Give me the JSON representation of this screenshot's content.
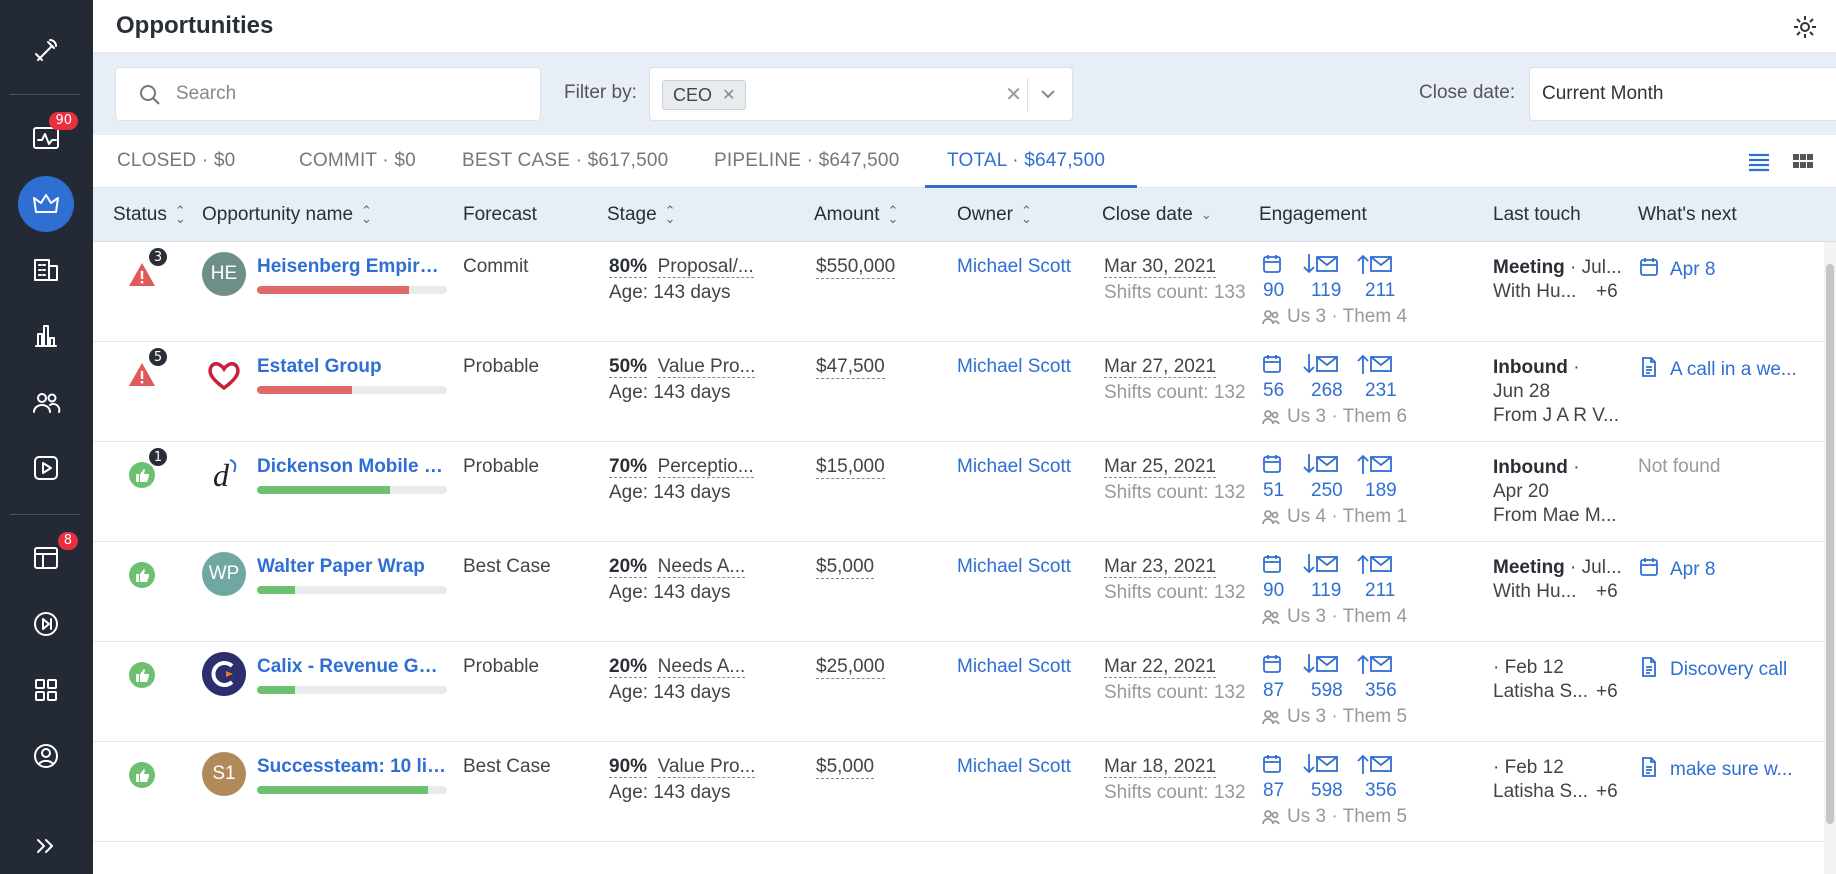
{
  "header": {
    "title": "Opportunities"
  },
  "sidebar": {
    "badges": {
      "activity": "90",
      "deals": "8"
    }
  },
  "filters": {
    "search_placeholder": "Search",
    "filter_label": "Filter by:",
    "filter_chip": "CEO",
    "close_label": "Close date:",
    "close_value": "Current Month"
  },
  "tabs": [
    {
      "label": "CLOSED · $0"
    },
    {
      "label": "COMMIT · $0"
    },
    {
      "label": "BEST CASE · $617,500"
    },
    {
      "label": "PIPELINE · $647,500"
    },
    {
      "label": "TOTAL · $647,500"
    }
  ],
  "columns": {
    "status": "Status",
    "name": "Opportunity name",
    "forecast": "Forecast",
    "stage": "Stage",
    "amount": "Amount",
    "owner": "Owner",
    "close": "Close date",
    "engagement": "Engagement",
    "last_touch": "Last touch",
    "whats_next": "What's next"
  },
  "colors": {
    "accent": "#2f6fd3",
    "danger": "#e05a5a",
    "success": "#6cc070",
    "sidebar": "#232a35"
  },
  "rows": [
    {
      "status": "warning",
      "status_count": "3",
      "avatar": {
        "type": "initials",
        "text": "HE",
        "color": "#6d8f87"
      },
      "name": "Heisenberg Empire ...",
      "progress": 0.8,
      "progress_color": "#e06a6a",
      "forecast": "Commit",
      "stage_pct": "80%",
      "stage_name": "Proposal/...",
      "age": "Age: 143 days",
      "amount": "$550,000",
      "owner": "Michael Scott",
      "close": "Mar 30, 2021",
      "shifts": "Shifts count: 133",
      "eng": {
        "meetings": "90",
        "inbound": "119",
        "outbound": "211",
        "us_them": "Us 3 · Them 4"
      },
      "lt_line1_b": "Meeting",
      "lt_line1": " · Jul...",
      "lt_line2": "With Hu...",
      "lt_line3": "",
      "lt_plus": "+6",
      "next": {
        "icon": "calendar",
        "text": "Apr 8"
      }
    },
    {
      "status": "warning",
      "status_count": "5",
      "avatar": {
        "type": "heart",
        "text": "",
        "color": "#ffffff"
      },
      "name": "Estatel Group",
      "progress": 0.5,
      "progress_color": "#e06a6a",
      "forecast": "Probable",
      "stage_pct": "50%",
      "stage_name": "Value Pro...",
      "age": "Age: 143 days",
      "amount": "$47,500",
      "owner": "Michael Scott",
      "close": "Mar 27, 2021",
      "shifts": "Shifts count: 132",
      "eng": {
        "meetings": "56",
        "inbound": "268",
        "outbound": "231",
        "us_them": "Us 3 · Them 6"
      },
      "lt_line1_b": "Inbound",
      "lt_line1": " ·",
      "lt_line2": "Jun 28",
      "lt_line3": "From J A R V...",
      "lt_plus": "",
      "next": {
        "icon": "doc",
        "text": "A call in a we..."
      }
    },
    {
      "status": "ok",
      "status_count": "1",
      "avatar": {
        "type": "dlogo",
        "text": "",
        "color": "#ffffff"
      },
      "name": "Dickenson Mobile G...",
      "progress": 0.7,
      "progress_color": "#6cc070",
      "forecast": "Probable",
      "stage_pct": "70%",
      "stage_name": "Perceptio...",
      "age": "Age: 143 days",
      "amount": "$15,000",
      "owner": "Michael Scott",
      "close": "Mar 25, 2021",
      "shifts": "Shifts count: 132",
      "eng": {
        "meetings": "51",
        "inbound": "250",
        "outbound": "189",
        "us_them": "Us 4 · Them 1"
      },
      "lt_line1_b": "Inbound",
      "lt_line1": " ·",
      "lt_line2": "Apr 20",
      "lt_line3": "From Mae M...",
      "lt_plus": "",
      "next": {
        "icon": "none",
        "text": "Not found"
      }
    },
    {
      "status": "ok",
      "status_count": "",
      "avatar": {
        "type": "initials",
        "text": "WP",
        "color": "#6fa8a2"
      },
      "name": "Walter Paper Wrap",
      "progress": 0.2,
      "progress_color": "#6cc070",
      "forecast": "Best Case",
      "stage_pct": "20%",
      "stage_name": "Needs A...",
      "age": "Age: 143 days",
      "amount": "$5,000",
      "owner": "Michael Scott",
      "close": "Mar 23, 2021",
      "shifts": "Shifts count: 132",
      "eng": {
        "meetings": "90",
        "inbound": "119",
        "outbound": "211",
        "us_them": "Us 3 · Them 4"
      },
      "lt_line1_b": "Meeting",
      "lt_line1": " · Jul...",
      "lt_line2": "With Hu...",
      "lt_line3": "",
      "lt_plus": "+6",
      "next": {
        "icon": "calendar",
        "text": "Apr 8"
      }
    },
    {
      "status": "ok",
      "status_count": "",
      "avatar": {
        "type": "clogo",
        "text": "",
        "color": "#2b2f6e"
      },
      "name": "Calix - Revenue Gui...",
      "progress": 0.2,
      "progress_color": "#6cc070",
      "forecast": "Probable",
      "stage_pct": "20%",
      "stage_name": "Needs A...",
      "age": "Age: 143 days",
      "amount": "$25,000",
      "owner": "Michael Scott",
      "close": "Mar 22, 2021",
      "shifts": "Shifts count: 132",
      "eng": {
        "meetings": "87",
        "inbound": "598",
        "outbound": "356",
        "us_them": "Us 3 · Them 5"
      },
      "lt_line1_b": "",
      "lt_line1": "· Feb 12",
      "lt_line2": "Latisha S...",
      "lt_line3": "",
      "lt_plus": "+6",
      "next": {
        "icon": "doc",
        "text": "Discovery call"
      }
    },
    {
      "status": "ok",
      "status_count": "",
      "avatar": {
        "type": "initials",
        "text": "S1",
        "color": "#b08a5a"
      },
      "name": "Successteam: 10 lic...",
      "progress": 0.9,
      "progress_color": "#6cc070",
      "forecast": "Best Case",
      "stage_pct": "90%",
      "stage_name": "Value Pro...",
      "age": "Age: 143 days",
      "amount": "$5,000",
      "owner": "Michael Scott",
      "close": "Mar 18, 2021",
      "shifts": "Shifts count: 132",
      "eng": {
        "meetings": "87",
        "inbound": "598",
        "outbound": "356",
        "us_them": "Us 3 · Them 5"
      },
      "lt_line1_b": "",
      "lt_line1": "· Feb 12",
      "lt_line2": "Latisha S...",
      "lt_line3": "",
      "lt_plus": "+6",
      "next": {
        "icon": "doc",
        "text": "make sure w..."
      }
    }
  ]
}
